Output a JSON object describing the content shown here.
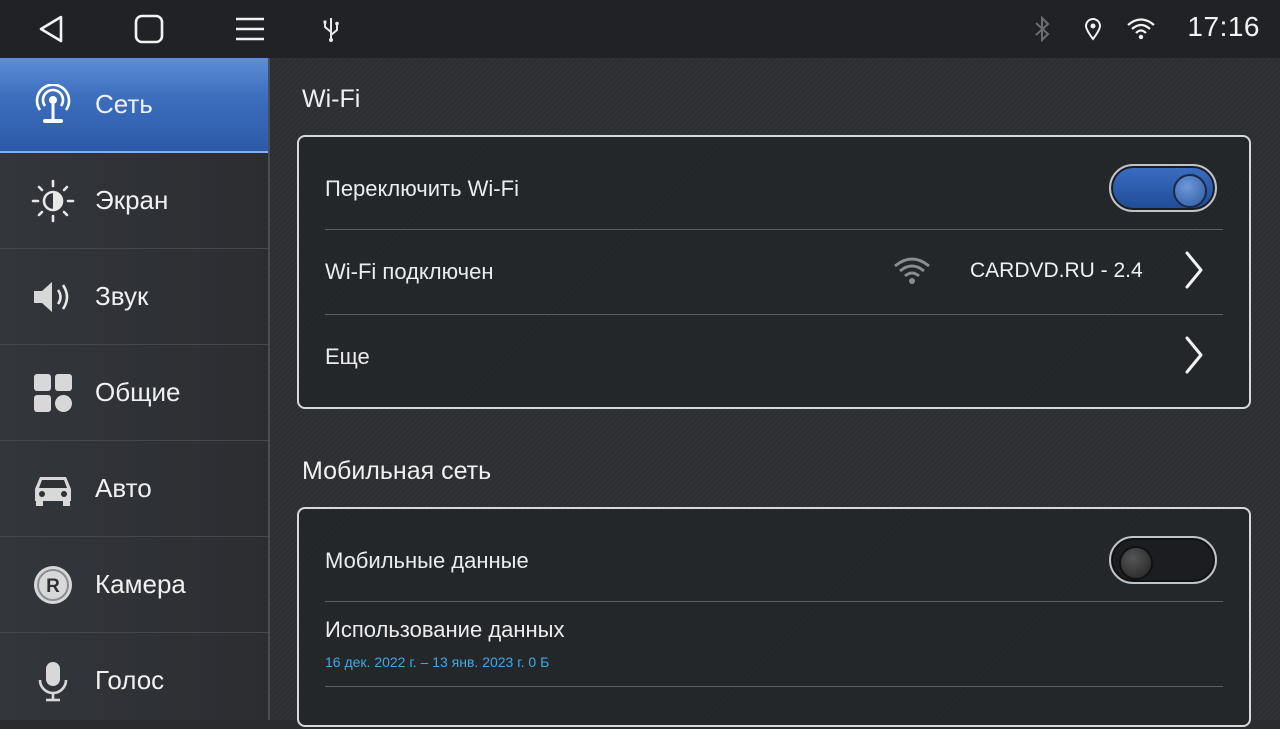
{
  "status_bar": {
    "back_icon": "back-triangle-icon",
    "home_icon": "home-square-icon",
    "menu_icon": "menu-lines-icon",
    "usb_icon": "usb-icon",
    "bluetooth_icon": "bluetooth-icon",
    "location_icon": "location-pin-icon",
    "wifi_icon": "wifi-icon",
    "time": "17:16"
  },
  "sidebar": {
    "items": [
      {
        "label": "Сеть",
        "icon": "network-antenna-icon",
        "active": true
      },
      {
        "label": "Экран",
        "icon": "brightness-icon",
        "active": false
      },
      {
        "label": "Звук",
        "icon": "speaker-icon",
        "active": false
      },
      {
        "label": "Общие",
        "icon": "grid-apps-icon",
        "active": false
      },
      {
        "label": "Авто",
        "icon": "car-icon",
        "active": false
      },
      {
        "label": "Камера",
        "icon": "rear-camera-icon",
        "active": false
      },
      {
        "label": "Голос",
        "icon": "microphone-icon",
        "active": false
      }
    ]
  },
  "wifi_section": {
    "title": "Wi-Fi",
    "toggle_label": "Переключить Wi-Fi",
    "toggle_state": "on",
    "connected_label": "Wi-Fi подключен",
    "network_name": "CARDVD.RU - 2.4",
    "more_label": "Еще"
  },
  "mobile_section": {
    "title": "Мобильная сеть",
    "data_label": "Мобильные данные",
    "data_toggle_state": "off",
    "usage_label": "Использование данных",
    "usage_detail": "16 дек. 2022 г. – 13 янв. 2023 г. 0 Б"
  },
  "colors": {
    "accent": "#3d6fbf",
    "detail_text": "#3fa9e6"
  }
}
